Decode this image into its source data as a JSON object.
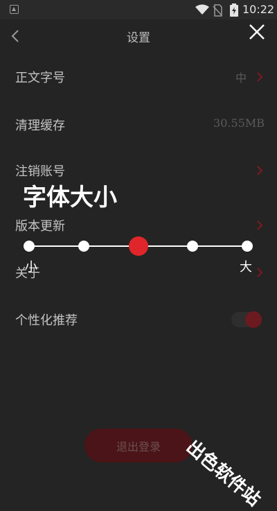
{
  "status_bar": {
    "time": "10:22",
    "icons": [
      "app-icon",
      "wifi-icon",
      "no-sim-icon",
      "battery-icon"
    ]
  },
  "header": {
    "title": "设置",
    "back_icon": "chevron-left-icon",
    "close_icon": "close-icon"
  },
  "settings": {
    "font_size": {
      "label": "正文字号",
      "value": "中"
    },
    "clear_cache": {
      "label": "清理缓存",
      "value": "30.55MB"
    },
    "cancel_account": {
      "label": "注销账号"
    },
    "version_update": {
      "label": "版本更新"
    },
    "about": {
      "label": "关于"
    },
    "personalized": {
      "label": "个性化推荐",
      "enabled": true
    }
  },
  "font_overlay": {
    "title": "字体大小",
    "min_label": "小",
    "max_label": "大",
    "levels": 5,
    "selected_level": 3
  },
  "logout": {
    "label": "退出登录"
  },
  "watermark": {
    "text": "出色软件站"
  },
  "colors": {
    "accent": "#e0262a",
    "background": "#242424",
    "chevron": "#7a1a20"
  }
}
